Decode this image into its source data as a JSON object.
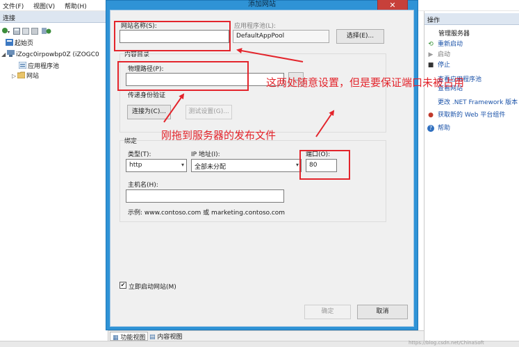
{
  "menu": {
    "file": "文件(F)",
    "view": "视图(V)",
    "help": "帮助(H)"
  },
  "connections": {
    "header": "连接",
    "tree": {
      "start_page": "起始页",
      "server": "iZogc0irpowbp0Z (iZOGC0",
      "app_pools": "应用程序池",
      "sites": "网站"
    }
  },
  "actions": {
    "header": "操作",
    "manage_server": "管理服务器",
    "restart": "重新启动",
    "start": "启动",
    "stop": "停止",
    "view_app_pools": "查看应用程序池",
    "view_sites": "查看网站",
    "change_net": "更改 .NET Framework 版本",
    "get_web_platform": "获取新的 Web 平台组件",
    "help": "帮助"
  },
  "bottom_tabs": {
    "features_view": "功能视图",
    "content_view": "内容视图"
  },
  "dialog": {
    "title": "添加网站",
    "close_glyph": "✕",
    "site_name_label": "网站名称(S):",
    "site_name_value": "",
    "app_pool_label": "应用程序池(L):",
    "app_pool_value": "DefaultAppPool",
    "select_button": "选择(E)...",
    "content_dir_label": "内容目录",
    "physical_path_label": "物理路径(P):",
    "physical_path_value": "",
    "browse_glyph": "...",
    "passthrough_label": "传递身份验证",
    "connect_as_button": "连接为(C)...",
    "test_settings_button": "测试设置(G)...",
    "binding_label": "绑定",
    "type_label": "类型(T):",
    "type_value": "http",
    "ip_label": "IP 地址(I):",
    "ip_value": "全部未分配",
    "port_label": "端口(O):",
    "port_value": "80",
    "hostname_label": "主机名(H):",
    "hostname_value": "",
    "example_text": "示例: www.contoso.com 或 marketing.contoso.com",
    "start_immediately_label": "立即启动网站(M)",
    "start_immediately_checked": true,
    "ok_button": "确定",
    "cancel_button": "取消"
  },
  "annotations": {
    "note1": "这两处随意设置，但是要保证端口未被占用",
    "note2": "刚拖到服务器的发布文件"
  },
  "watermark": "https://blog.csdn.net/ChinaSoft"
}
